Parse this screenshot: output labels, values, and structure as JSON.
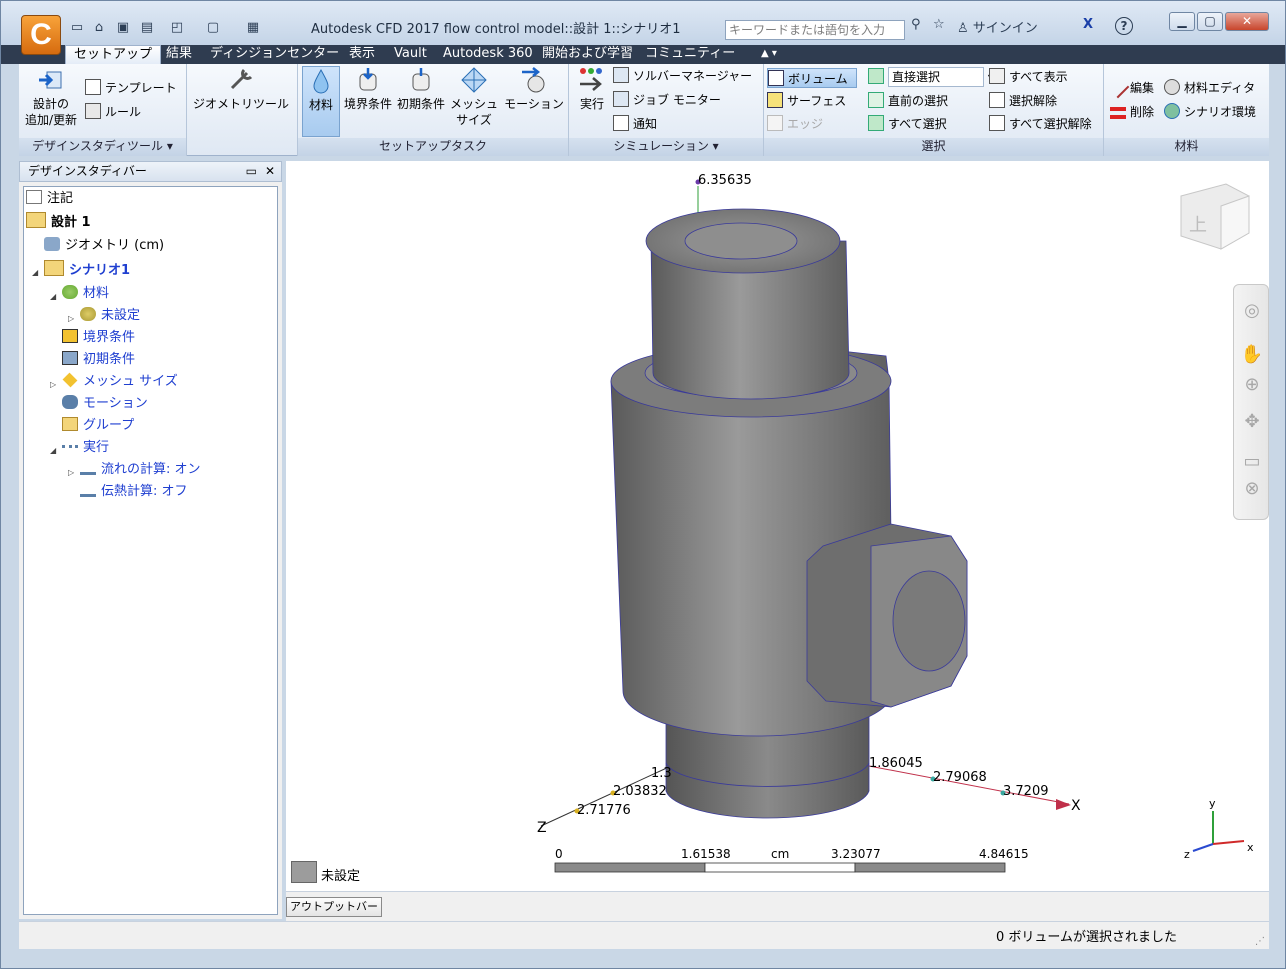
{
  "window": {
    "title": "Autodesk CFD 2017   flow control model::設計  1::シナリオ1",
    "app_logo": "C",
    "search_placeholder": "キーワードまたは語句を入力",
    "signin": "サインイン",
    "help": "?"
  },
  "tabs": [
    "セットアップ",
    "結果",
    "ディシジョンセンター",
    "表示",
    "Vault",
    "Autodesk 360",
    "開始および学習",
    "コミュニティー"
  ],
  "ribbon": {
    "design_tools": {
      "add_update": "設計の",
      "add_update2": "追加/更新",
      "template": "テンプレート",
      "rule": "ルール",
      "footer": "デザインスタディツール ▾"
    },
    "geometry_tools": "ジオメトリツール",
    "setup_tasks": {
      "material": "材料",
      "boundary": "境界条件",
      "initial": "初期条件",
      "mesh": "メッシュ",
      "mesh2": "サイズ",
      "motion": "モーション",
      "footer": "セットアップタスク"
    },
    "simulation": {
      "run": "実行",
      "solver_manager": "ソルバーマネージャー",
      "job_monitor": "ジョブ モニター",
      "notify": "通知",
      "footer": "シミュレーション ▾"
    },
    "selection": {
      "volume": "ボリューム",
      "surface": "サーフェス",
      "edge": "エッジ",
      "direct_select": "直接選択",
      "previous": "直前の選択",
      "select_all": "すべて選択",
      "show_all": "すべて表示",
      "deselect": "選択解除",
      "deselect_all": "すべて選択解除",
      "footer": "選択"
    },
    "materials": {
      "edit": "編集",
      "editor": "材料エディタ",
      "delete": "削除",
      "scenario_env": "シナリオ環境",
      "footer": "材料"
    }
  },
  "left_panel": {
    "title": "デザインスタディバー",
    "tree": {
      "notes": "注記",
      "design": "設計  1",
      "geometry": "ジオメトリ (cm)",
      "scenario": "シナリオ1",
      "materials": "材料",
      "unset": "未設定",
      "boundary": "境界条件",
      "initial": "初期条件",
      "mesh": "メッシュ サイズ",
      "motion": "モーション",
      "group": "グループ",
      "run": "実行",
      "flow": "流れの計算: オン",
      "heat": "伝熱計算: オフ"
    }
  },
  "viewport": {
    "top_label": "6.35635",
    "x_labels": [
      "1.86045",
      "2.79068",
      "3.7209"
    ],
    "z_labels": [
      "1.3",
      "2.03832",
      "2.71776"
    ],
    "axis_x": "X",
    "axis_z": "Z",
    "scale": {
      "ticks": [
        "0",
        "1.61538",
        "cm",
        "3.23077",
        "4.84615"
      ]
    },
    "legend": "未設定",
    "triad": {
      "x": "x",
      "y": "y",
      "z": "z"
    },
    "viewcube_face": "上"
  },
  "output_bar": "アウトプットバー",
  "status": "0 ボリュームが選択されました",
  "colors": {
    "accent": "#2f3c50",
    "model": "#808080",
    "link": "#1f3fd0"
  }
}
